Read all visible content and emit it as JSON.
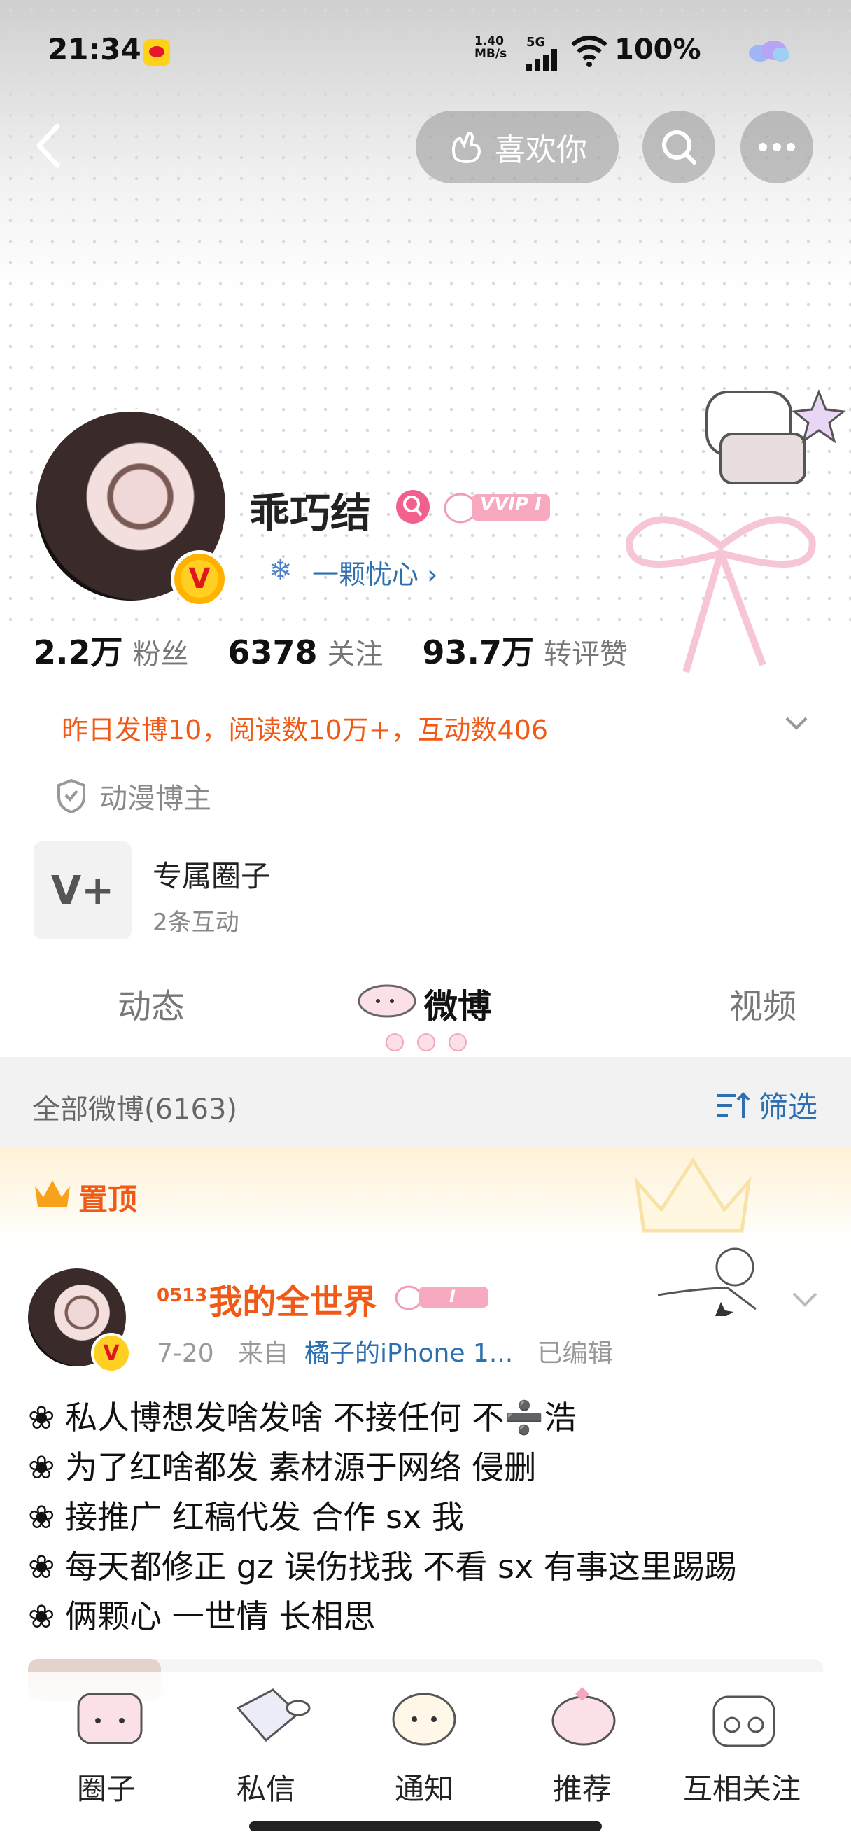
{
  "status": {
    "time": "21:34",
    "net_speed_top": "1.40",
    "net_speed_unit": "MB/s",
    "network": "5G",
    "battery": "100%"
  },
  "header": {
    "like_label": "喜欢你"
  },
  "profile": {
    "name": "乖巧结",
    "vip_label": "VVIP I",
    "verify_label": "V",
    "signature": "一颗忧心",
    "stats": [
      {
        "num": "2.2万",
        "label": "粉丝"
      },
      {
        "num": "6378",
        "label": "关注"
      },
      {
        "num": "93.7万",
        "label": "转评赞"
      }
    ],
    "activity": "昨日发博10，阅读数10万+，互动数406",
    "tag": "动漫博主",
    "circle": {
      "title": "专属圈子",
      "sub": "2条互动",
      "icon_text": "V+"
    }
  },
  "tabs": [
    {
      "label": "动态",
      "active": false
    },
    {
      "label": "微博",
      "active": true
    },
    {
      "label": "视频",
      "active": false
    }
  ],
  "feed": {
    "all_label": "全部微博(6163)",
    "filter_label": "筛选",
    "pinned_label": "置顶"
  },
  "post": {
    "name_prefix": "0513",
    "name": "我的全世界",
    "badge_text": "I",
    "date": "7-20",
    "from_label": "来自",
    "source": "橘子的iPhone 1...",
    "edited": "已编辑",
    "lines": [
      "❀ 私人博想发啥发啥 不接任何 不➗浩",
      "❀ 为了红啥都发 素材源于网络 侵删",
      "❀ 接推广 红稿代发 合作 sx 我",
      "❀ 每天都修正 gz 误伤找我 不看 sx 有事这里踢踢",
      "❀ 俩颗心 一世情 长相思"
    ]
  },
  "bottom_nav": [
    {
      "label": "圈子",
      "icon": "circle-cat-icon"
    },
    {
      "label": "私信",
      "icon": "message-cat-icon"
    },
    {
      "label": "通知",
      "icon": "notice-cat-icon"
    },
    {
      "label": "推荐",
      "icon": "recommend-cat-icon"
    },
    {
      "label": "互相关注",
      "icon": "mutual-follow-cat-icon"
    }
  ],
  "colors": {
    "accent_orange": "#f05a16",
    "link_blue": "#2e6fb0",
    "vip_pink": "#f2608e"
  }
}
